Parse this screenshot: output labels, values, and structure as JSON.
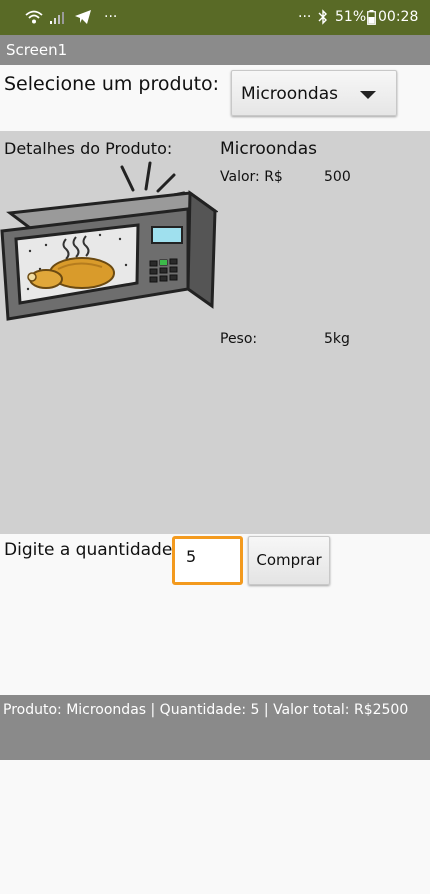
{
  "status_bar": {
    "more_left": "···",
    "more_right": "···",
    "battery": "51%",
    "time": "00:28",
    "icons": [
      "wifi-icon",
      "signal-icon",
      "telegram-icon",
      "bluetooth-icon",
      "battery-icon"
    ]
  },
  "title_bar": {
    "title": "Screen1"
  },
  "selector": {
    "label": "Selecione um produto:",
    "selected": "Microondas"
  },
  "details": {
    "heading": "Detalhes do Produto:",
    "product_name": "Microondas",
    "price_label": "Valor: R$",
    "price_value": "500",
    "weight_label": "Peso:",
    "weight_value": "5kg",
    "image": "microwave-illustration"
  },
  "quantity": {
    "label": "Digite a quantidade",
    "value": "5",
    "buy_label": "Comprar"
  },
  "result": {
    "text": "Produto: Microondas | Quantidade: 5 | Valor total: R$2500"
  },
  "colors": {
    "status_bar": "#596a26",
    "title_bar": "#8b8b8b",
    "panel": "#d0d0d0",
    "result_bar": "#8a8a8a",
    "input_focus": "#f39a1e",
    "background": "#f9f9f9"
  }
}
